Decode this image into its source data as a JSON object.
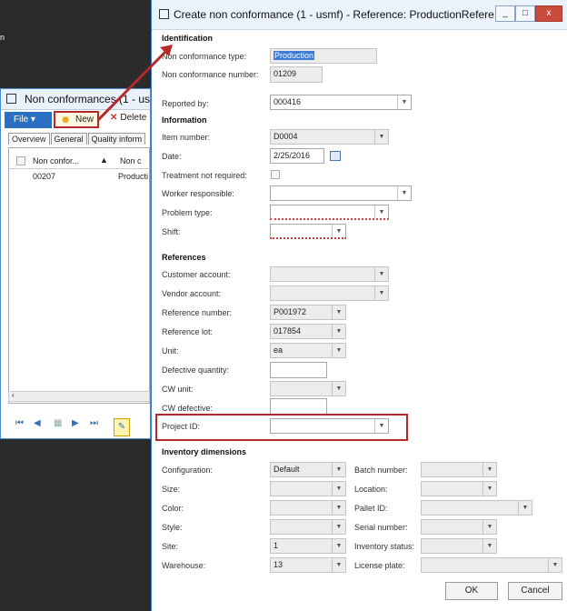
{
  "background": {
    "side_text": "n",
    "window_title": "Non conformances (1 - us",
    "file_label": "File",
    "new_label": "New",
    "delete_label": "Delete",
    "tabs": [
      "Overview",
      "General",
      "Quality inform"
    ],
    "grid_headers": [
      "Non confor...",
      "Non c"
    ],
    "grid_row": [
      "00207",
      "Producti"
    ]
  },
  "dialog": {
    "title": "Create non conformance (1 - usmf) - Reference: ProductionRefere...",
    "window_buttons": [
      "_",
      "□",
      "x"
    ],
    "sections": {
      "identification": "Identification",
      "information": "Information",
      "references": "References",
      "inventory": "Inventory dimensions"
    },
    "fields": {
      "nc_type": {
        "label": "Non conformance type:",
        "value": "Production"
      },
      "nc_number": {
        "label": "Non conformance number:",
        "value": "01209"
      },
      "reported_by": {
        "label": "Reported by:",
        "value": "000416"
      },
      "item_number": {
        "label": "Item number:",
        "value": "D0004"
      },
      "date": {
        "label": "Date:",
        "value": "2/25/2016"
      },
      "treatment": {
        "label": "Treatment not required:"
      },
      "worker": {
        "label": "Worker responsible:",
        "value": ""
      },
      "problem": {
        "label": "Problem type:",
        "value": ""
      },
      "shift": {
        "label": "Shift:",
        "value": ""
      },
      "customer": {
        "label": "Customer account:",
        "value": ""
      },
      "vendor": {
        "label": "Vendor account:",
        "value": ""
      },
      "ref_number": {
        "label": "Reference number:",
        "value": "P001972"
      },
      "ref_lot": {
        "label": "Reference lot:",
        "value": "017854"
      },
      "unit": {
        "label": "Unit:",
        "value": "ea"
      },
      "def_qty": {
        "label": "Defective quantity:",
        "value": ""
      },
      "cw_unit": {
        "label": "CW unit:",
        "value": ""
      },
      "cw_def": {
        "label": "CW defective:",
        "value": ""
      },
      "project": {
        "label": "Project ID:",
        "value": ""
      },
      "config": {
        "label": "Configuration:",
        "value": "Default"
      },
      "size": {
        "label": "Size:",
        "value": ""
      },
      "color": {
        "label": "Color:",
        "value": ""
      },
      "style": {
        "label": "Style:",
        "value": ""
      },
      "site": {
        "label": "Site:",
        "value": "1"
      },
      "warehouse": {
        "label": "Warehouse:",
        "value": "13"
      },
      "batch": {
        "label": "Batch number:",
        "value": ""
      },
      "location": {
        "label": "Location:",
        "value": ""
      },
      "pallet": {
        "label": "Pallet ID:",
        "value": ""
      },
      "serial": {
        "label": "Serial number:",
        "value": ""
      },
      "inv_status": {
        "label": "Inventory status:",
        "value": ""
      },
      "license": {
        "label": "License plate:",
        "value": ""
      }
    },
    "ok_label": "OK",
    "cancel_label": "Cancel"
  },
  "colors": {
    "accent": "#2b6fc2",
    "highlight": "#b42a2a"
  }
}
